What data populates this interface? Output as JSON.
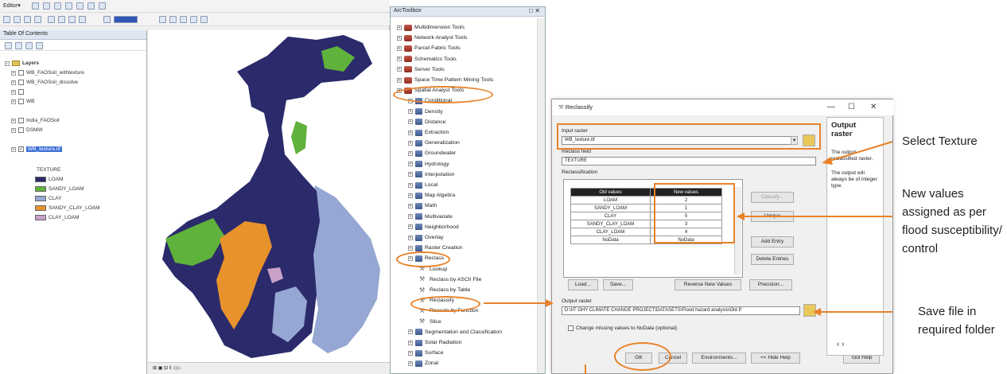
{
  "arcmap": {
    "editor_label": "Editor▾",
    "toc_title": "Table Of Contents",
    "toc_root": "Layers",
    "layers": [
      {
        "name": "WB_FAOSoil_withtexture",
        "checked": false
      },
      {
        "name": "WB_FAOSoil_dissolve",
        "checked": false
      },
      {
        "name": "",
        "checked": false
      },
      {
        "name": "WB",
        "checked": false
      },
      {
        "name": "India_FAOSoil",
        "checked": false
      },
      {
        "name": "DSMW",
        "checked": false
      },
      {
        "name": "WB_texture.tif",
        "checked": true,
        "selected": true
      }
    ],
    "legend_heading": "TEXTURE",
    "legend": [
      {
        "label": "LOAM",
        "color": "#2b2a6b"
      },
      {
        "label": "SANDY_LOAM",
        "color": "#5fb23c"
      },
      {
        "label": "CLAY",
        "color": "#95a7d2"
      },
      {
        "label": "SANDY_CLAY_LOAM",
        "color": "#e8922c"
      },
      {
        "label": "CLAY_LOAM",
        "color": "#c9a0c8"
      }
    ],
    "status_text": "⊞ ▣ ⊟ ‖ ◁ ▷"
  },
  "toolbox": {
    "title": "ArcToolbox",
    "items": [
      {
        "label": "Multidimension Tools",
        "level": 0,
        "icon": "toolbox"
      },
      {
        "label": "Network Analyst Tools",
        "level": 0,
        "icon": "toolbox"
      },
      {
        "label": "Parcel Fabric Tools",
        "level": 0,
        "icon": "toolbox"
      },
      {
        "label": "Schematics Tools",
        "level": 0,
        "icon": "toolbox"
      },
      {
        "label": "Server Tools",
        "level": 0,
        "icon": "toolbox"
      },
      {
        "label": "Space Time Pattern Mining Tools",
        "level": 0,
        "icon": "toolbox"
      },
      {
        "label": "Spatial Analyst Tools",
        "level": 0,
        "icon": "toolbox"
      },
      {
        "label": "Conditional",
        "level": 1,
        "icon": "toolset"
      },
      {
        "label": "Density",
        "level": 1,
        "icon": "toolset"
      },
      {
        "label": "Distance",
        "level": 1,
        "icon": "toolset"
      },
      {
        "label": "Extraction",
        "level": 1,
        "icon": "toolset"
      },
      {
        "label": "Generalization",
        "level": 1,
        "icon": "toolset"
      },
      {
        "label": "Groundwater",
        "level": 1,
        "icon": "toolset"
      },
      {
        "label": "Hydrology",
        "level": 1,
        "icon": "toolset"
      },
      {
        "label": "Interpolation",
        "level": 1,
        "icon": "toolset"
      },
      {
        "label": "Local",
        "level": 1,
        "icon": "toolset"
      },
      {
        "label": "Map Algebra",
        "level": 1,
        "icon": "toolset"
      },
      {
        "label": "Math",
        "level": 1,
        "icon": "toolset"
      },
      {
        "label": "Multivariate",
        "level": 1,
        "icon": "toolset"
      },
      {
        "label": "Neighborhood",
        "level": 1,
        "icon": "toolset"
      },
      {
        "label": "Overlay",
        "level": 1,
        "icon": "toolset"
      },
      {
        "label": "Raster Creation",
        "level": 1,
        "icon": "toolset"
      },
      {
        "label": "Reclass",
        "level": 1,
        "icon": "toolset"
      },
      {
        "label": "Lookup",
        "level": 2,
        "icon": "tool"
      },
      {
        "label": "Reclass by ASCII File",
        "level": 2,
        "icon": "tool"
      },
      {
        "label": "Reclass by Table",
        "level": 2,
        "icon": "tool"
      },
      {
        "label": "Reclassify",
        "level": 2,
        "icon": "tool"
      },
      {
        "label": "Rescale by Function",
        "level": 2,
        "icon": "tool"
      },
      {
        "label": "Slice",
        "level": 2,
        "icon": "tool"
      },
      {
        "label": "Segmentation and Classification",
        "level": 1,
        "icon": "toolset"
      },
      {
        "label": "Solar Radiation",
        "level": 1,
        "icon": "toolset"
      },
      {
        "label": "Surface",
        "level": 1,
        "icon": "toolset"
      },
      {
        "label": "Zonal",
        "level": 1,
        "icon": "toolset"
      }
    ]
  },
  "dialog": {
    "title": "Reclassify",
    "input_raster_label": "Input raster",
    "input_raster_value": "WB_texture.tif",
    "reclass_field_label": "Reclass field",
    "reclass_field_value": "TEXTURE",
    "reclassification_label": "Reclassification",
    "table_headers": [
      "Old values",
      "New values"
    ],
    "rows": [
      {
        "old": "LOAM",
        "new": "2"
      },
      {
        "old": "SANDY_LOAM",
        "new": "1"
      },
      {
        "old": "CLAY",
        "new": "5"
      },
      {
        "old": "SANDY_CLAY_LOAM",
        "new": "3"
      },
      {
        "old": "CLAY_LOAM",
        "new": "4"
      },
      {
        "old": "NoData",
        "new": "NoData"
      }
    ],
    "buttons": {
      "classify": "Classify...",
      "unique": "Unique",
      "add_entry": "Add Entry",
      "delete_entries": "Delete Entries",
      "load": "Load...",
      "save": "Save...",
      "reverse": "Reverse New Values",
      "precision": "Precision...",
      "ok": "OK",
      "cancel": "Cancel",
      "environments": "Environments...",
      "hide_help": "<< Hide Help",
      "tool_help": "Tool Help"
    },
    "output_raster_label": "Output raster",
    "output_raster_value": "D:\\IIT GHY CLIMATE CHANGE PROJECT\\DATASETS\\Flood hazard analysis\\Old P",
    "nodata_checkbox_label": "Change missing values to NoData (optional)",
    "help_title": "Output raster",
    "help_p1": "The output reclassified raster.",
    "help_p2": "The output will always be of integer type."
  },
  "annotations": {
    "select_texture": "Select Texture",
    "new_values": "New values assigned as per flood susceptibility/ control",
    "save_file": "Save file in required folder"
  }
}
